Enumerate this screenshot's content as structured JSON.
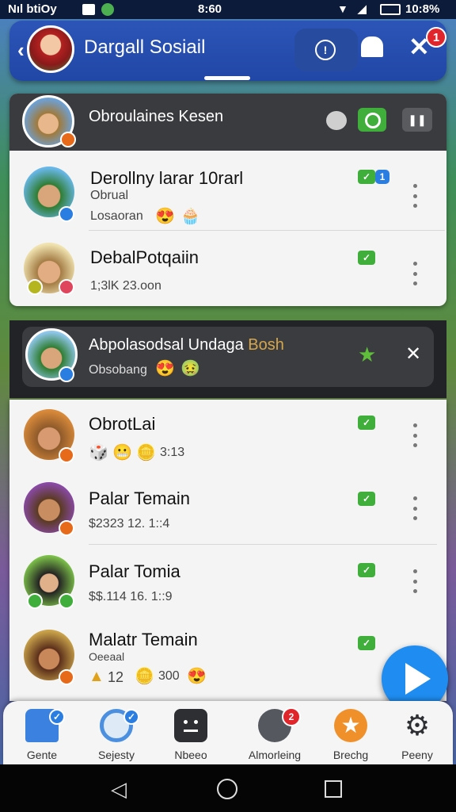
{
  "status_bar": {
    "left": "Nıl btiOy",
    "time": "8:60",
    "battery": "10:8%"
  },
  "header": {
    "title": "Dargall Sosiail",
    "notification_count": "1"
  },
  "top_group": {
    "title": "Obroulaines Kesen"
  },
  "list_items_a": [
    {
      "name": "Derollny larar 10rarl",
      "sub": "Obrual",
      "meta": "Losaoran",
      "badge_count": "1"
    },
    {
      "name": "DebalPotqaiin",
      "sub": "",
      "meta": "1;3lK 23.oon"
    }
  ],
  "highlight": {
    "title_main": "Abpolasodsal Undaga",
    "title_accent": "Bosh",
    "subtitle": "Obsobang"
  },
  "list_items_b": [
    {
      "name": "ObrotLai",
      "meta": "3:13"
    },
    {
      "name": "Palar Temain",
      "meta": "$2323 12. 1::4"
    },
    {
      "name": "Palar Tomia",
      "meta": "$$.114 16. 1::9"
    },
    {
      "name": "Malatr Temain",
      "sub": "Oeeaal",
      "meta_a": "12",
      "meta_b": "300"
    }
  ],
  "bottom_nav": [
    {
      "label": "Gente",
      "icon": "home-icon"
    },
    {
      "label": "Sejesty",
      "icon": "compass-icon"
    },
    {
      "label": "Nbeeo",
      "icon": "chat-icon"
    },
    {
      "label": "Almorleing",
      "icon": "chips-icon",
      "badge": "2"
    },
    {
      "label": "Brechg",
      "icon": "star-icon"
    },
    {
      "label": "Peeny",
      "icon": "gear-icon"
    }
  ],
  "colors": {
    "header_blue": "#2147a6",
    "accent_green": "#3fae3a",
    "notification_red": "#e0252b",
    "fab_blue": "#1e8cf0",
    "highlight_gold": "#d6a64a"
  }
}
